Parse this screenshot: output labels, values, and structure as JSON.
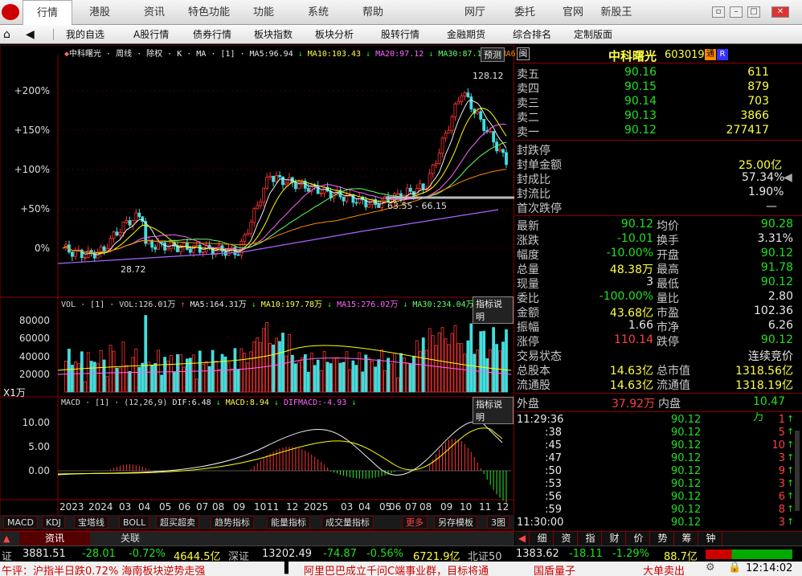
{
  "menubar": {
    "items": [
      "行情",
      "港股",
      "资讯",
      "特色功能",
      "功能",
      "系统",
      "帮助"
    ],
    "right_items": [
      "网厅",
      "委托",
      "官网",
      "新股王"
    ],
    "window_controls": [
      "minimize",
      "restore",
      "maximize",
      "close"
    ]
  },
  "nav2": {
    "items": [
      "我的自选",
      "A股行情",
      "债券行情",
      "板块指数",
      "板块分析",
      "股转行情",
      "金融期货",
      "综合排名",
      "定制版面"
    ],
    "icons": [
      "home-icon",
      "back-icon"
    ]
  },
  "kline": {
    "header": "◆中科曙光 · 周线 · 除权 · K · MA · [1] · MA5:96.94 ↓ MA10:103.43 ↓ MA20:97.12 ↓ MA30:87.12 ↓ MA6",
    "ma5": "MA5:96.94",
    "ma10": "MA10:103.43",
    "ma20": "MA20:97.12",
    "ma30": "MA30:87.12",
    "forecast_btn": "预测",
    "y_labels": [
      "+200%",
      "+150%",
      "+100%",
      "+50%",
      "0%"
    ],
    "annotations": [
      "128.12",
      "28.72",
      "63.55 - 66.15"
    ]
  },
  "vol": {
    "header": "VOL · [1] · VOL:126.01万 ↑ MA5:164.31万 ↓ MA10:197.78万 ↓ MA15:276.02万 ↓ MA30:234.04万 ↓ MA6",
    "explain_btn": "指标说明",
    "y_labels": [
      "80000",
      "60000",
      "40000",
      "20000"
    ],
    "unit": "X1万"
  },
  "macd": {
    "header": "MACD · [1] · (12,26,9) DIF:6.48 ↓ MACD:8.94 ↓ DIFMACD:-4.93 ↓",
    "explain_btn": "指标说明",
    "y_labels": [
      "10.00",
      "5.00",
      "0.00"
    ],
    "x_labels": [
      "2023",
      "2024",
      "03",
      "04",
      "05",
      "06",
      "07",
      "08",
      "09",
      "10",
      "11",
      "12",
      "2025",
      "03",
      "04",
      "05",
      "06",
      "07",
      "08",
      "09",
      "10",
      "11",
      "12"
    ]
  },
  "indicator_tabs": [
    "MACD",
    "KDJ",
    "宝塔线",
    "BOLL",
    "超买超卖",
    "趋势指标",
    "能量指标",
    "成交量指标",
    "更多",
    "另存模板",
    "3图"
  ],
  "bottom_tabs": [
    "资讯",
    "关联"
  ],
  "quote": {
    "icon_label": "闽",
    "name": "中科曙光",
    "code": "603019",
    "badges": [
      "通",
      "R"
    ],
    "asks": [
      {
        "label": "卖五",
        "price": "90.16",
        "vol": "611"
      },
      {
        "label": "卖四",
        "price": "90.15",
        "vol": "879"
      },
      {
        "label": "卖三",
        "price": "90.14",
        "vol": "703"
      },
      {
        "label": "卖二",
        "price": "90.13",
        "vol": "3866"
      },
      {
        "label": "卖一",
        "price": "90.12",
        "vol": "277417"
      }
    ],
    "limit": {
      "status": "封跌停",
      "seal_amount_label": "封单金额",
      "seal_amount": "25.00亿",
      "seal_ratio_label": "封成比",
      "seal_ratio": "57.34%",
      "float_ratio_label": "封流比",
      "float_ratio": "1.90%",
      "first_label": "首次跌停",
      "first": "—"
    },
    "stats": [
      {
        "l1": "最新",
        "v1": "90.12",
        "l2": "均价",
        "v2": "90.28"
      },
      {
        "l1": "涨跌",
        "v1": "-10.01",
        "l2": "换手",
        "v2": "3.31%"
      },
      {
        "l1": "幅度",
        "v1": "-10.00%",
        "l2": "开盘",
        "v2": "90.12"
      },
      {
        "l1": "总量",
        "v1": "48.38万",
        "l2": "最高",
        "v2": "91.78"
      },
      {
        "l1": "现量",
        "v1": "3",
        "l2": "最低",
        "v2": "90.12"
      },
      {
        "l1": "委比",
        "v1": "-100.00%",
        "l2": "量比",
        "v2": "2.80"
      },
      {
        "l1": "金额",
        "v1": "43.68亿",
        "l2": "市盈",
        "v2": "102.36"
      },
      {
        "l1": "振幅",
        "v1": "1.66",
        "l2": "市净",
        "v2": "6.26"
      },
      {
        "l1": "涨停",
        "v1": "110.14",
        "l2": "跌停",
        "v2": "90.12"
      },
      {
        "l1": "交易状态",
        "v1": "",
        "l2": "",
        "v2": "连续竞价"
      },
      {
        "l1": "总股本",
        "v1": "14.63亿",
        "l2": "总市值",
        "v2": "1318.56亿"
      },
      {
        "l1": "流通股",
        "v1": "14.63亿",
        "l2": "流通值",
        "v2": "1318.19亿"
      }
    ],
    "outer_label": "外盘",
    "outer": "37.92万",
    "inner_label": "内盘",
    "inner": "10.47万",
    "ticks": [
      {
        "t": "11:29:36",
        "p": "90.12",
        "v": "1"
      },
      {
        "t": ":38",
        "p": "90.12",
        "v": "5"
      },
      {
        "t": ":45",
        "p": "90.12",
        "v": "10"
      },
      {
        "t": ":47",
        "p": "90.12",
        "v": "3"
      },
      {
        "t": ":50",
        "p": "90.12",
        "v": "9"
      },
      {
        "t": ":53",
        "p": "90.12",
        "v": "3"
      },
      {
        "t": ":56",
        "p": "90.12",
        "v": "6"
      },
      {
        "t": ":59",
        "p": "90.12",
        "v": "8"
      },
      {
        "t": "11:30:00",
        "p": "90.12",
        "v": "3"
      }
    ],
    "func_tabs": [
      "细",
      "资",
      "指",
      "财",
      "价",
      "势",
      "筹",
      "钟"
    ]
  },
  "status": {
    "sh_label": "证",
    "sh": "3881.51",
    "sh_chg": "-28.01",
    "sh_pct": "-0.72%",
    "sh_amt": "4644.5亿",
    "sz_label": "深证",
    "sz": "13202.49",
    "sz_chg": "-74.87",
    "sz_pct": "-0.56%",
    "sz_amt": "6721.9亿",
    "bz_label": "北证50",
    "bz": "1383.62",
    "bz_chg": "-18.11",
    "bz_pct": "-1.29%",
    "bz_amt": "88.7亿",
    "news1": "午评：沪指半日跌0.72% 海南板块逆势走强",
    "news2": "阿里巴巴成立千问C端事业群，目标将通",
    "news3": "国盾量子",
    "news4": "大单卖出",
    "time": "12:14:02"
  }
}
